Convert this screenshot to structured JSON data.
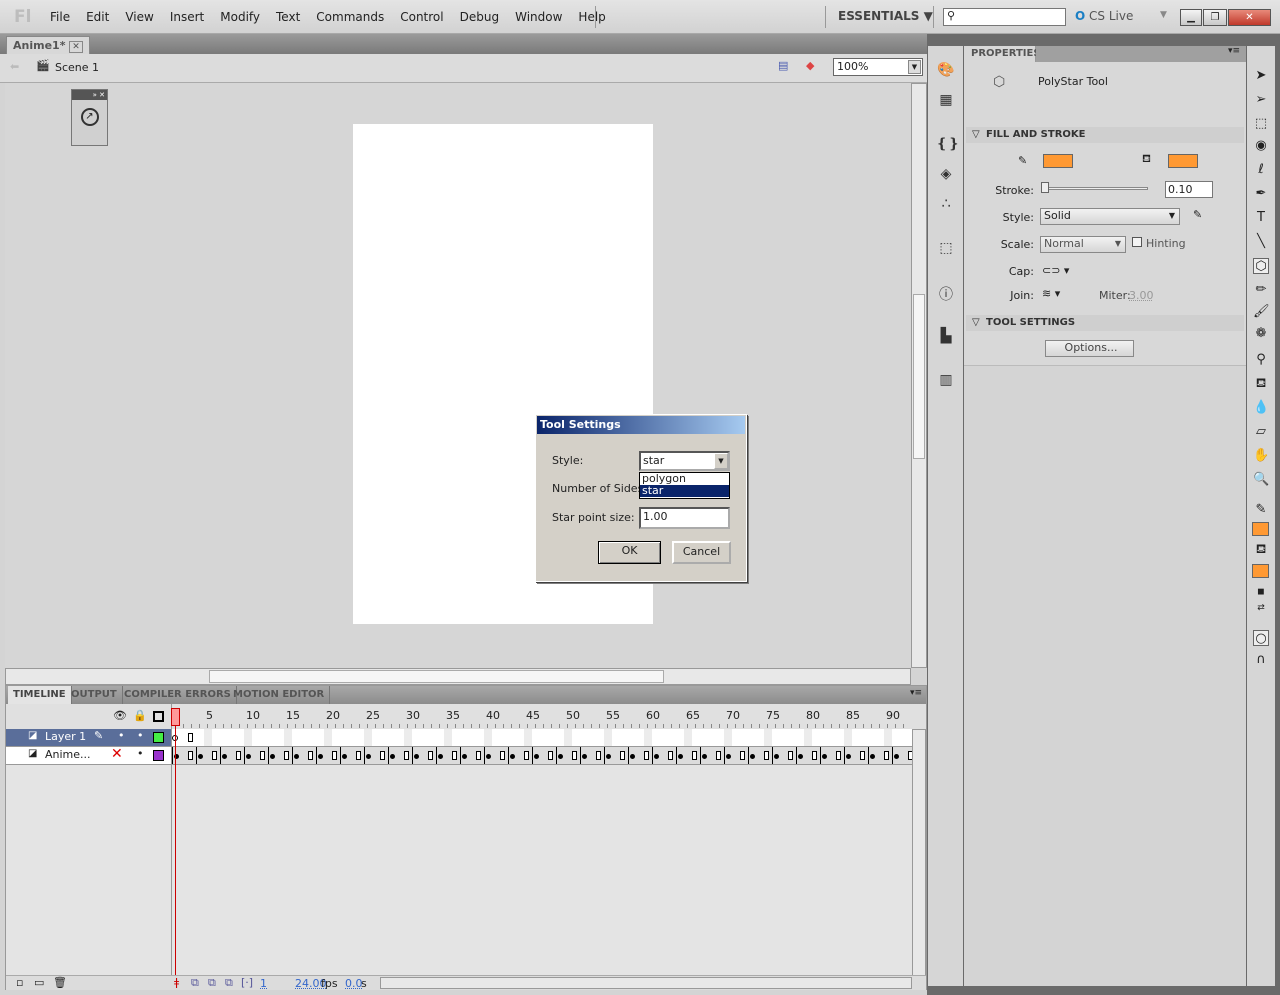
{
  "app": {
    "logo": "Fl",
    "menus": [
      "File",
      "Edit",
      "View",
      "Insert",
      "Modify",
      "Text",
      "Commands",
      "Control",
      "Debug",
      "Window",
      "Help"
    ],
    "workspace": "ESSENTIALS ▼",
    "search_value": "",
    "cs_live": "CS Live"
  },
  "document": {
    "tab": "Anime1*",
    "scene": "Scene 1",
    "zoom": "100%"
  },
  "dialog": {
    "title": "Tool Settings",
    "style_label": "Style:",
    "style_value": "star",
    "options": [
      "polygon",
      "star"
    ],
    "selected_option": "star",
    "sides_label": "Number of Sides:",
    "point_label": "Star point size:",
    "point_value": "1.00",
    "ok": "OK",
    "cancel": "Cancel"
  },
  "timeline": {
    "tabs": [
      "TIMELINE",
      "OUTPUT",
      "COMPILER ERRORS",
      "MOTION EDITOR"
    ],
    "frame_numbers": [
      "1",
      "5",
      "10",
      "15",
      "20",
      "25",
      "30",
      "35",
      "40",
      "45",
      "50",
      "55",
      "60",
      "65",
      "70",
      "75",
      "80",
      "85",
      "90"
    ],
    "layers": [
      {
        "name": "Layer 1",
        "color": "#44ee44",
        "selected": true
      },
      {
        "name": "Anime...",
        "color": "#9933cc",
        "selected": false
      }
    ],
    "current_frame": "1",
    "fps": "24.00",
    "fps_unit": "fps",
    "time": "0.0",
    "time_unit": "s"
  },
  "properties": {
    "tab": "PROPERTIES",
    "tool_name": "PolyStar Tool",
    "fill_stroke": "FILL AND STROKE",
    "stroke_color": "#ff9933",
    "fill_color": "#ff9933",
    "stroke_label": "Stroke:",
    "stroke_value": "0.10",
    "stroke_level": 0.0,
    "style_label": "Style:",
    "style_value": "Solid",
    "scale_label": "Scale:",
    "scale_value": "Normal",
    "hinting": "Hinting",
    "hinting_checked": false,
    "cap_label": "Cap:",
    "join_label": "Join:",
    "miter_label": "Miter:",
    "miter_value": "3.00",
    "tool_settings": "TOOL SETTINGS",
    "options": "Options..."
  }
}
